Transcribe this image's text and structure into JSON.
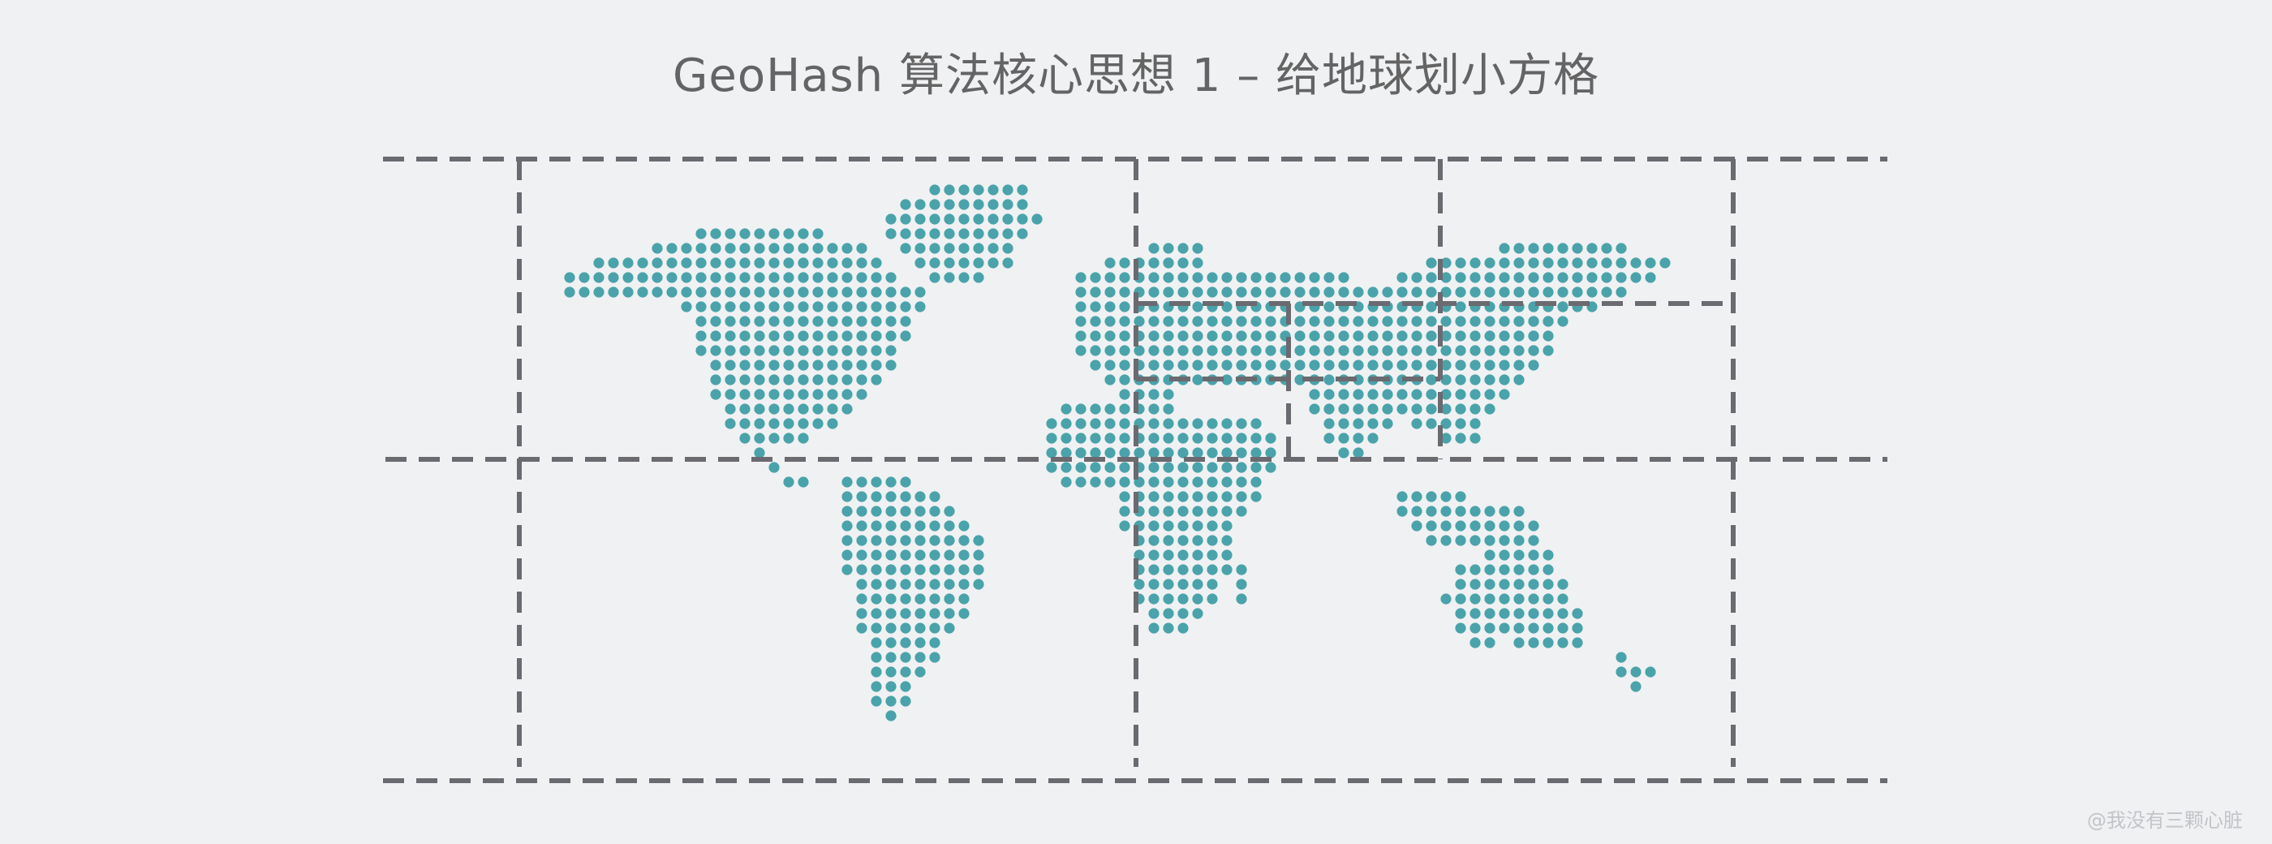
{
  "title": "GeoHash 算法核心思想 1 – 给地球划小方格",
  "watermark": "@我没有三颗心脏",
  "colors": {
    "background": "#f0f1f3",
    "dot": "#4aa3aa",
    "grid_line": "#6a6a70",
    "title_text": "#646464"
  },
  "map": {
    "description_icon": "world-map-dot-matrix-icon",
    "continents": [
      "north-america",
      "greenland",
      "south-america",
      "europe",
      "africa",
      "asia",
      "australia"
    ]
  },
  "grid": {
    "style": "dashed",
    "nested_subdivision": "top-right cell subdivided twice"
  }
}
